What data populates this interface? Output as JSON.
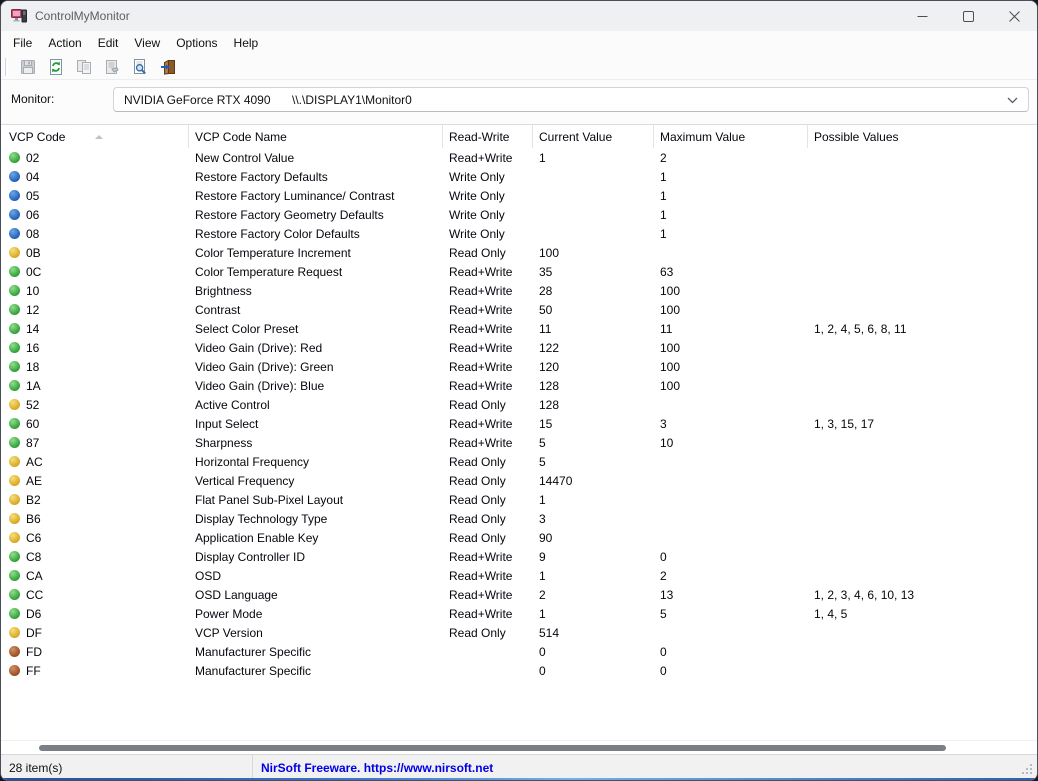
{
  "window": {
    "title": "ControlMyMonitor"
  },
  "menu": {
    "items": [
      "File",
      "Action",
      "Edit",
      "View",
      "Options",
      "Help"
    ]
  },
  "toolbar": {
    "buttons": [
      {
        "name": "save",
        "enabled": false
      },
      {
        "name": "refresh",
        "enabled": true
      },
      {
        "name": "copy",
        "enabled": false
      },
      {
        "name": "properties",
        "enabled": false
      },
      {
        "name": "find",
        "enabled": true
      },
      {
        "name": "exit",
        "enabled": true
      }
    ]
  },
  "monitor": {
    "label": "Monitor:",
    "device": "NVIDIA GeForce RTX 4090",
    "path": "\\\\.\\DISPLAY1\\Monitor0"
  },
  "table": {
    "columns": [
      {
        "label": "VCP Code",
        "sort": "asc"
      },
      {
        "label": "VCP Code Name"
      },
      {
        "label": "Read-Write"
      },
      {
        "label": "Current Value"
      },
      {
        "label": "Maximum Value"
      },
      {
        "label": "Possible Values"
      }
    ],
    "rows": [
      {
        "code": "02",
        "dot": "green",
        "name": "New Control Value",
        "rw": "Read+Write",
        "current": "1",
        "max": "2",
        "possible": ""
      },
      {
        "code": "04",
        "dot": "blue",
        "name": "Restore Factory Defaults",
        "rw": "Write Only",
        "current": "",
        "max": "1",
        "possible": ""
      },
      {
        "code": "05",
        "dot": "blue",
        "name": "Restore Factory Luminance/ Contrast",
        "rw": "Write Only",
        "current": "",
        "max": "1",
        "possible": ""
      },
      {
        "code": "06",
        "dot": "blue",
        "name": "Restore Factory Geometry Defaults",
        "rw": "Write Only",
        "current": "",
        "max": "1",
        "possible": ""
      },
      {
        "code": "08",
        "dot": "blue",
        "name": "Restore Factory Color Defaults",
        "rw": "Write Only",
        "current": "",
        "max": "1",
        "possible": ""
      },
      {
        "code": "0B",
        "dot": "yellow",
        "name": "Color Temperature Increment",
        "rw": "Read Only",
        "current": "100",
        "max": "",
        "possible": ""
      },
      {
        "code": "0C",
        "dot": "green",
        "name": "Color Temperature Request",
        "rw": "Read+Write",
        "current": "35",
        "max": "63",
        "possible": ""
      },
      {
        "code": "10",
        "dot": "green",
        "name": "Brightness",
        "rw": "Read+Write",
        "current": "28",
        "max": "100",
        "possible": ""
      },
      {
        "code": "12",
        "dot": "green",
        "name": "Contrast",
        "rw": "Read+Write",
        "current": "50",
        "max": "100",
        "possible": ""
      },
      {
        "code": "14",
        "dot": "green",
        "name": "Select Color Preset",
        "rw": "Read+Write",
        "current": "11",
        "max": "11",
        "possible": "1, 2, 4, 5, 6, 8, 11"
      },
      {
        "code": "16",
        "dot": "green",
        "name": "Video Gain (Drive): Red",
        "rw": "Read+Write",
        "current": "122",
        "max": "100",
        "possible": ""
      },
      {
        "code": "18",
        "dot": "green",
        "name": "Video Gain (Drive): Green",
        "rw": "Read+Write",
        "current": "120",
        "max": "100",
        "possible": ""
      },
      {
        "code": "1A",
        "dot": "green",
        "name": "Video Gain (Drive): Blue",
        "rw": "Read+Write",
        "current": "128",
        "max": "100",
        "possible": ""
      },
      {
        "code": "52",
        "dot": "yellow",
        "name": "Active Control",
        "rw": "Read Only",
        "current": "128",
        "max": "",
        "possible": ""
      },
      {
        "code": "60",
        "dot": "green",
        "name": "Input Select",
        "rw": "Read+Write",
        "current": "15",
        "max": "3",
        "possible": "1, 3, 15, 17"
      },
      {
        "code": "87",
        "dot": "green",
        "name": "Sharpness",
        "rw": "Read+Write",
        "current": "5",
        "max": "10",
        "possible": ""
      },
      {
        "code": "AC",
        "dot": "yellow",
        "name": "Horizontal Frequency",
        "rw": "Read Only",
        "current": "5",
        "max": "",
        "possible": ""
      },
      {
        "code": "AE",
        "dot": "yellow",
        "name": "Vertical Frequency",
        "rw": "Read Only",
        "current": "14470",
        "max": "",
        "possible": ""
      },
      {
        "code": "B2",
        "dot": "yellow",
        "name": "Flat Panel Sub-Pixel Layout",
        "rw": "Read Only",
        "current": "1",
        "max": "",
        "possible": ""
      },
      {
        "code": "B6",
        "dot": "yellow",
        "name": "Display Technology Type",
        "rw": "Read Only",
        "current": "3",
        "max": "",
        "possible": ""
      },
      {
        "code": "C6",
        "dot": "yellow",
        "name": "Application Enable Key",
        "rw": "Read Only",
        "current": "90",
        "max": "",
        "possible": ""
      },
      {
        "code": "C8",
        "dot": "green",
        "name": "Display Controller ID",
        "rw": "Read+Write",
        "current": "9",
        "max": "0",
        "possible": ""
      },
      {
        "code": "CA",
        "dot": "green",
        "name": "OSD",
        "rw": "Read+Write",
        "current": "1",
        "max": "2",
        "possible": ""
      },
      {
        "code": "CC",
        "dot": "green",
        "name": "OSD Language",
        "rw": "Read+Write",
        "current": "2",
        "max": "13",
        "possible": "1, 2, 3, 4, 6, 10, 13"
      },
      {
        "code": "D6",
        "dot": "green",
        "name": "Power Mode",
        "rw": "Read+Write",
        "current": "1",
        "max": "5",
        "possible": "1, 4, 5"
      },
      {
        "code": "DF",
        "dot": "yellow",
        "name": "VCP Version",
        "rw": "Read Only",
        "current": "514",
        "max": "",
        "possible": ""
      },
      {
        "code": "FD",
        "dot": "brown",
        "name": "Manufacturer Specific",
        "rw": "",
        "current": "0",
        "max": "0",
        "possible": ""
      },
      {
        "code": "FF",
        "dot": "brown",
        "name": "Manufacturer Specific",
        "rw": "",
        "current": "0",
        "max": "0",
        "possible": ""
      }
    ]
  },
  "statusbar": {
    "items_count": "28 item(s)",
    "freeware_text": "NirSoft Freeware. https://www.nirsoft.net"
  },
  "colors": {
    "dot_green_light": "#8fe08a",
    "dot_green_dark": "#2c9b35",
    "dot_blue_light": "#6aa7e8",
    "dot_blue_dark": "#1f5ab2",
    "dot_yellow_light": "#f6e07a",
    "dot_yellow_dark": "#d6a31d",
    "dot_brown_light": "#d09066",
    "dot_brown_dark": "#96491c",
    "link_blue": "#0000e6"
  }
}
